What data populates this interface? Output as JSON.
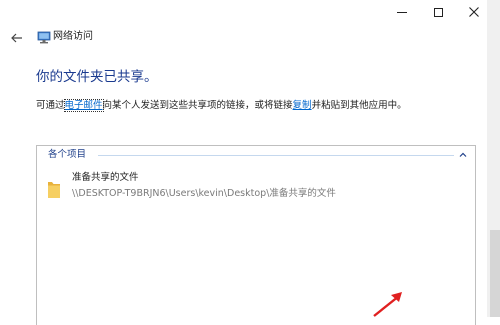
{
  "window": {
    "title": "网络访问",
    "controls": {
      "minimize": "minimize",
      "maximize": "maximize",
      "close": "close"
    }
  },
  "main": {
    "heading": "你的文件夹已共享。",
    "description": {
      "part1": "可通过",
      "email_link": "电子邮件",
      "part2": "向某个人发送到这些共享项的链接，或将链接",
      "copy_link": "复制",
      "part3": "并粘贴到其他应用中。"
    }
  },
  "items_panel": {
    "group_label": "各个项目",
    "items": [
      {
        "name": "准备共享的文件",
        "path": "\\\\DESKTOP-T9BRJN6\\Users\\kevin\\Desktop\\准备共享的文件",
        "icon": "folder-icon"
      }
    ]
  },
  "colors": {
    "heading": "#1a3a8f",
    "link": "#0066cc",
    "group_label": "#1e3f8a",
    "folder": "#f4c85a",
    "annotation_arrow": "#e02020"
  }
}
